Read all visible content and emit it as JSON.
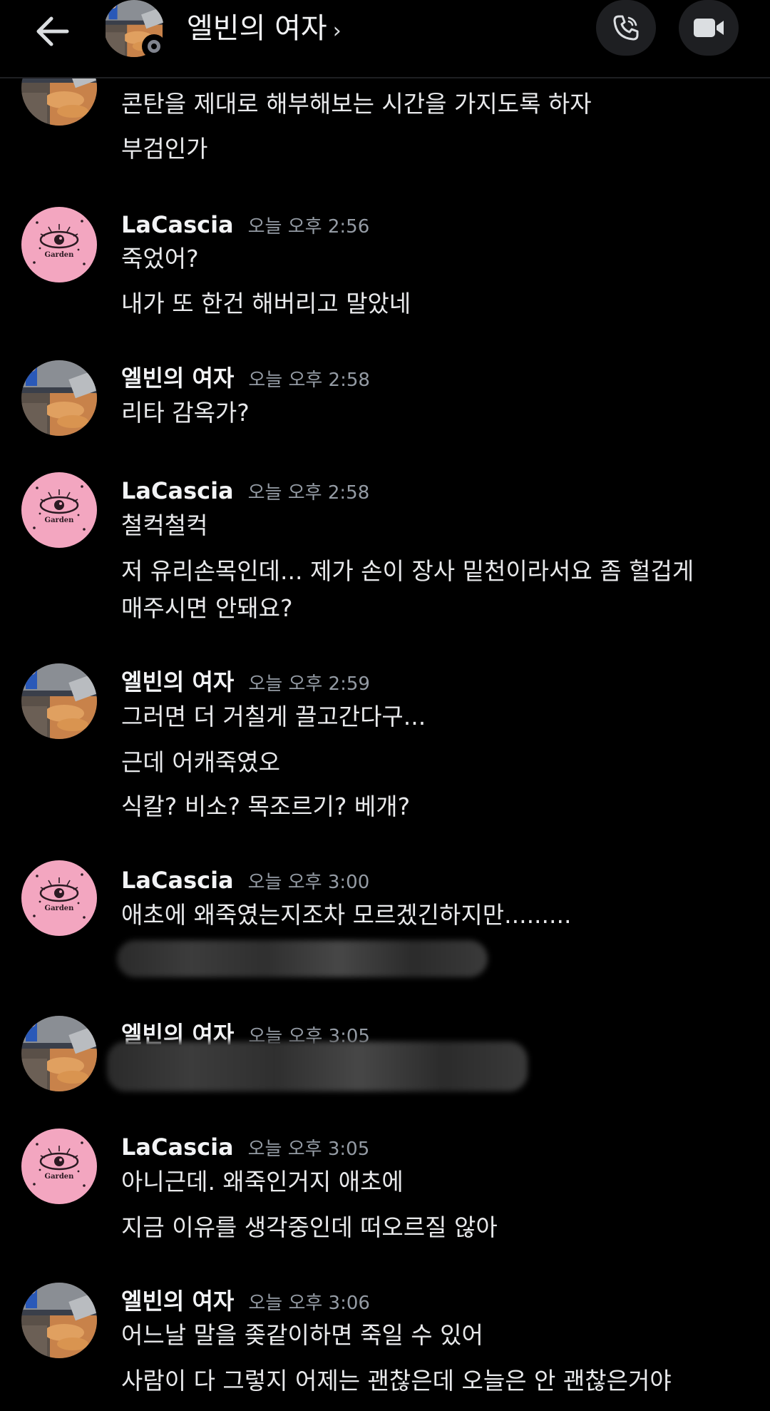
{
  "header": {
    "title": "엘빈의 여자",
    "chevron": "›",
    "back_icon": "arrow-left-icon",
    "call_icon": "phone-icon",
    "video_icon": "video-camera-icon"
  },
  "messages": [
    {
      "lines": [
        "콘탄을 제대로 해부해보는 시간을 가지도록 하자",
        "부검인가"
      ]
    },
    {
      "author": "LaCascia",
      "time": "오늘 오후 2:56",
      "lines": [
        "죽었어?",
        "내가 또 한건 해버리고 말았네"
      ]
    },
    {
      "author": "엘빈의 여자",
      "time": "오늘 오후 2:58",
      "lines": [
        "리타 감옥가?"
      ]
    },
    {
      "author": "LaCascia",
      "time": "오늘 오후 2:58",
      "lines": [
        "철컥철컥",
        "저 유리손목인데... 제가 손이 장사 밑천이라서요 좀 헐겁게",
        "매주시면 안돼요?"
      ]
    },
    {
      "author": "엘빈의 여자",
      "time": "오늘 오후 2:59",
      "lines": [
        "그러면 더 거칠게 끌고간다구...",
        "근데 어캐죽였오",
        "식칼? 비소? 목조르기? 베개?"
      ]
    },
    {
      "author": "LaCascia",
      "time": "오늘 오후 3:00",
      "lines": [
        "애초에 왜죽였는지조차 모르겠긴하지만........."
      ]
    },
    {
      "author": "엘빈의 여자",
      "time": "오늘 오후 3:05",
      "lines": []
    },
    {
      "author": "LaCascia",
      "time": "오늘 오후 3:05",
      "lines": [
        "아니근데. 왜죽인거지 애초에",
        "지금 이유를 생각중인데 떠오르질 않아"
      ]
    },
    {
      "author": "엘빈의 여자",
      "time": "오늘 오후 3:06",
      "lines": [
        "어느날 말을 좆같이하면 죽일 수 있어",
        "사람이 다 그렇지 어제는 괜찮은데 오늘은 안 괜찮은거야"
      ]
    }
  ],
  "colors": {
    "background": "#000000",
    "pink_avatar": "#f3a6c0",
    "timestamp": "#949ba4",
    "text": "#e8e9eb"
  }
}
